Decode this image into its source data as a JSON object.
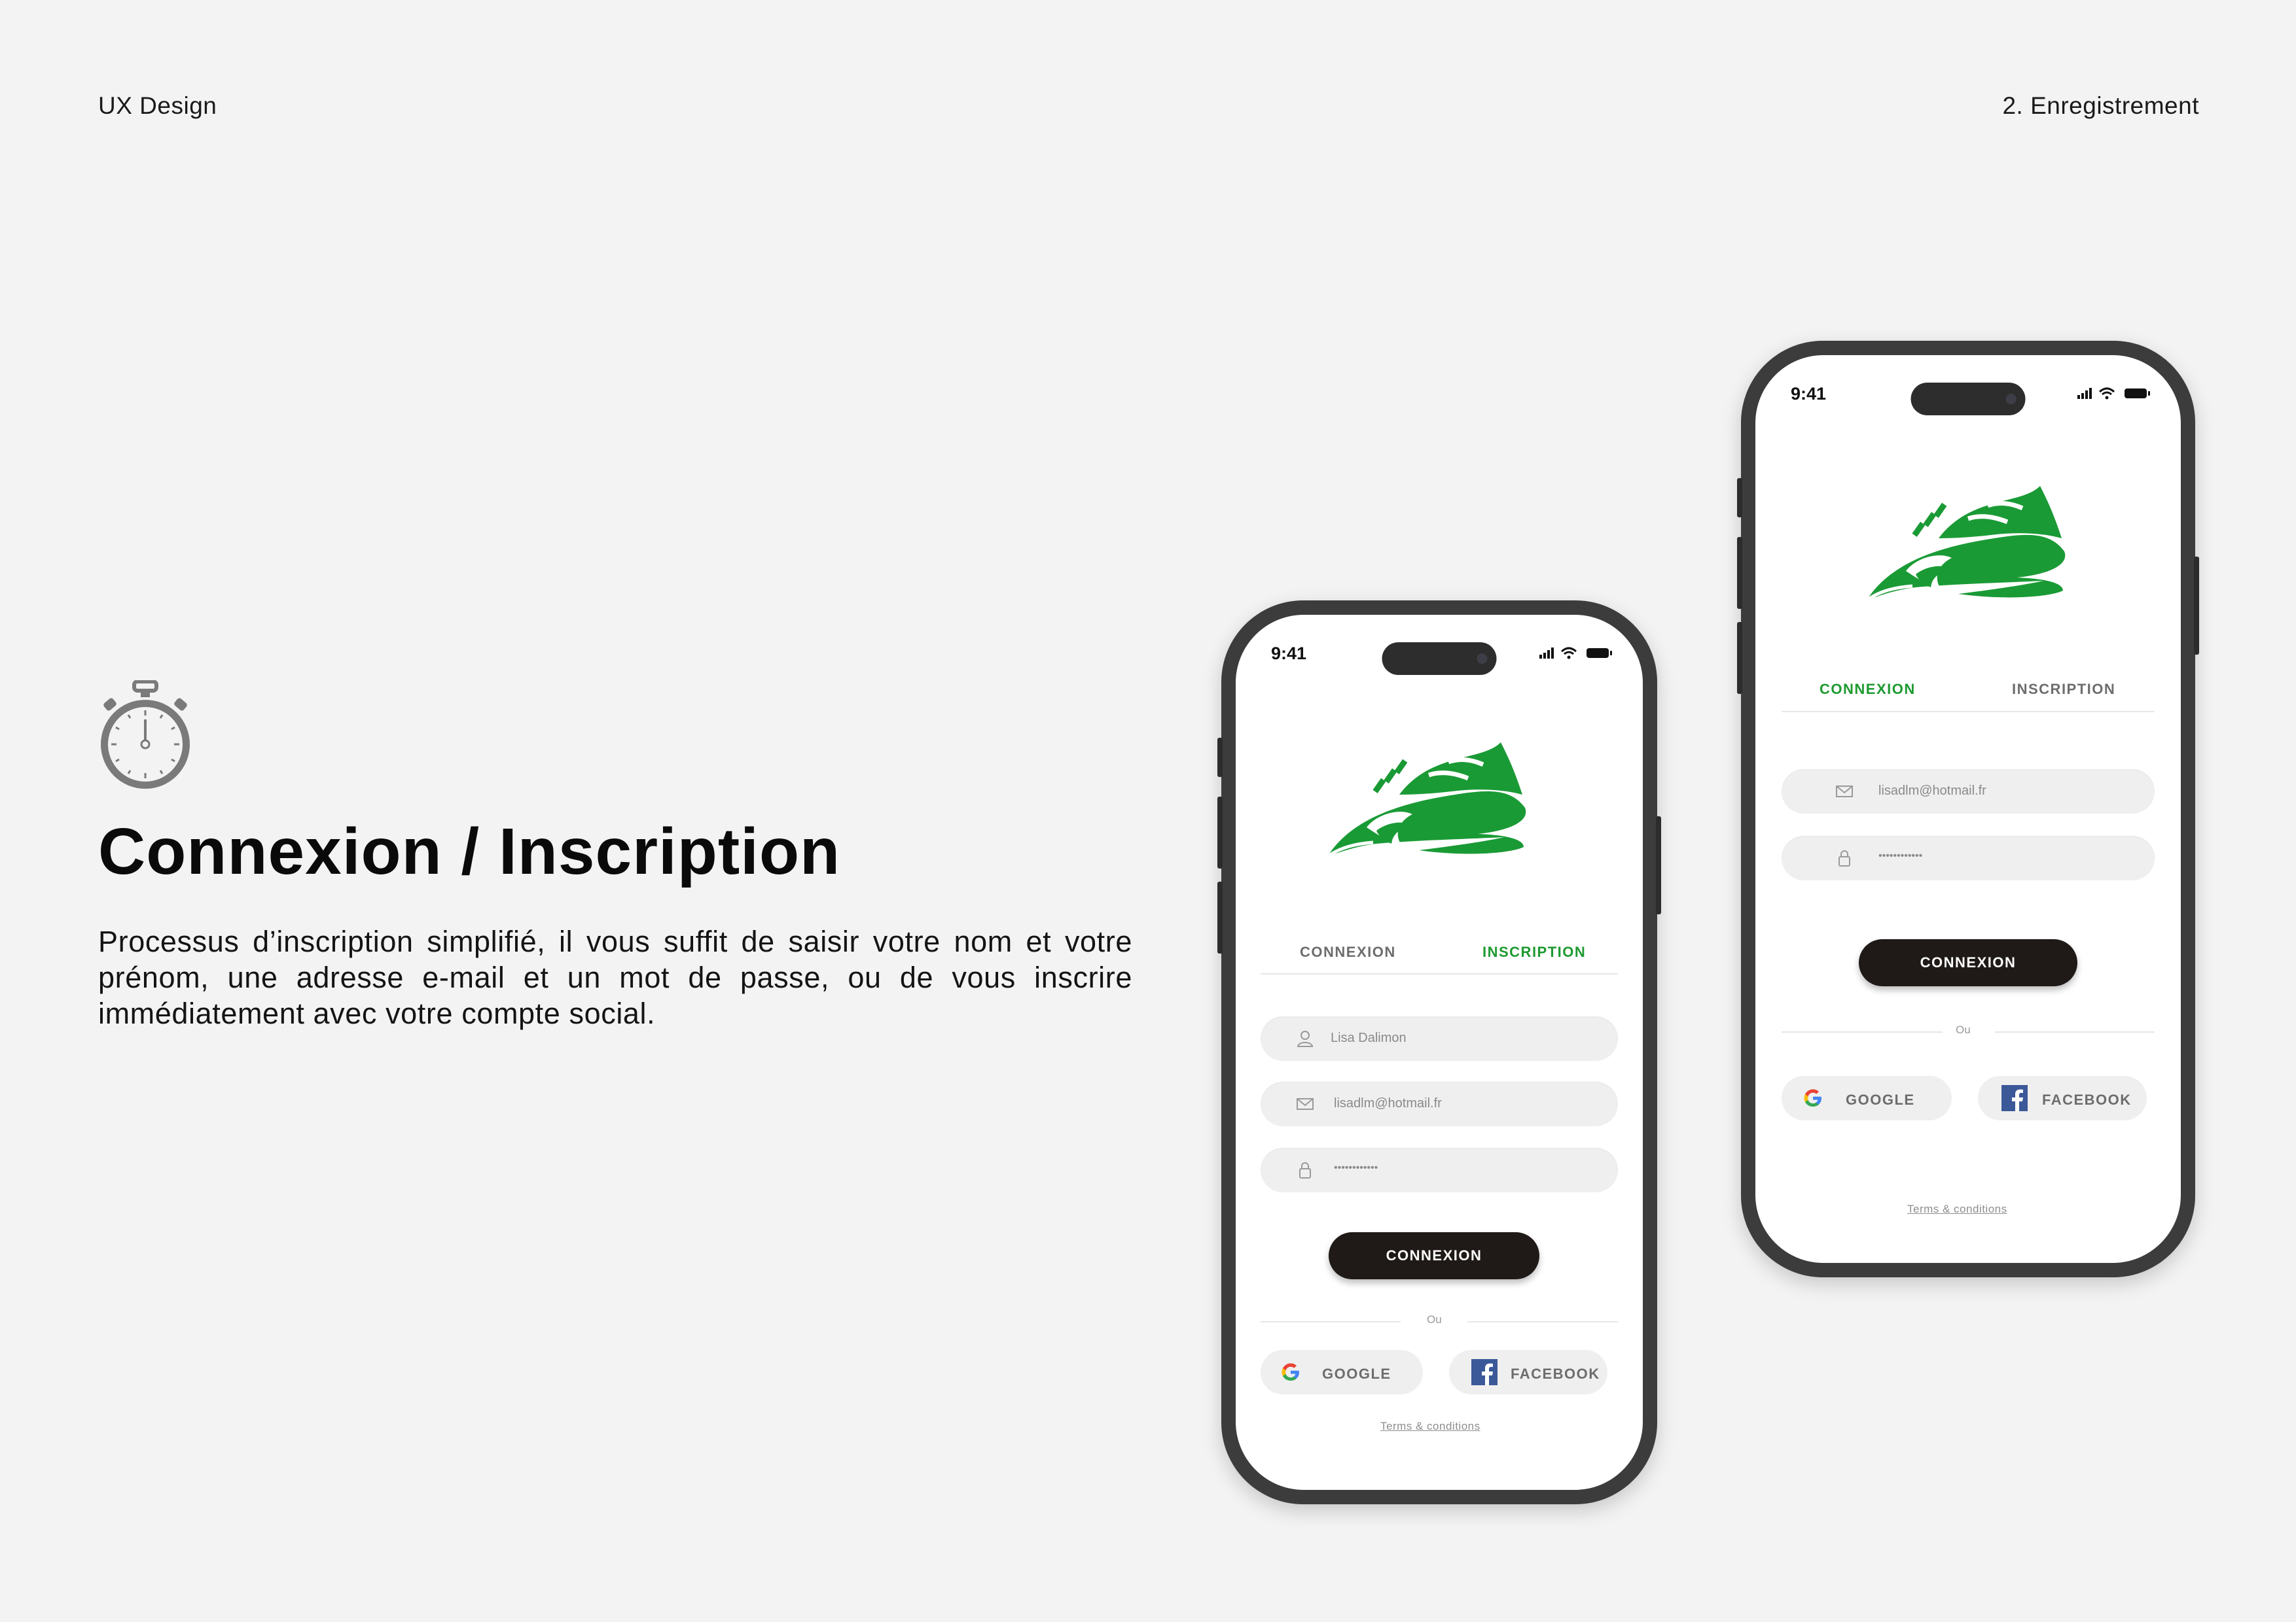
{
  "header": {
    "left": "UX Design",
    "right": "2. Enregistrement"
  },
  "hero": {
    "icon": "stopwatch-icon",
    "title": "Connexion / Inscription",
    "description": "Processus d’inscription simplifié, il vous suffit de saisir votre nom et votre prénom, une adresse e-mail et un mot de passe, ou de vous inscrire immédiatement avec votre compte social."
  },
  "colors": {
    "accent": "#1e9a30",
    "button": "#1f1a17",
    "background": "#f3f3f3",
    "frame": "#3c3c3c"
  },
  "phone_signup": {
    "time": "9:41",
    "logo": "running-shoe-logo",
    "tabs": {
      "login": "CONNEXION",
      "signup": "INSCRIPTION",
      "active": "signup"
    },
    "fields": {
      "name": {
        "icon": "user-icon",
        "value": "Lisa Dalimon"
      },
      "email": {
        "icon": "mail-icon",
        "value": "lisadlm@hotmail.fr"
      },
      "password": {
        "icon": "lock-icon",
        "value": "••••••••••••"
      }
    },
    "submit": "CONNEXION",
    "separator": "Ou",
    "social": {
      "google": "GOOGLE",
      "facebook": "FACEBOOK"
    },
    "terms": "Terms & conditions"
  },
  "phone_login": {
    "time": "9:41",
    "logo": "running-shoe-logo",
    "tabs": {
      "login": "CONNEXION",
      "signup": "INSCRIPTION",
      "active": "login"
    },
    "fields": {
      "email": {
        "icon": "mail-icon",
        "value": "lisadlm@hotmail.fr"
      },
      "password": {
        "icon": "lock-icon",
        "value": "••••••••••••"
      }
    },
    "submit": "CONNEXION",
    "separator": "Ou",
    "social": {
      "google": "GOOGLE",
      "facebook": "FACEBOOK"
    },
    "terms": "Terms & conditions"
  }
}
